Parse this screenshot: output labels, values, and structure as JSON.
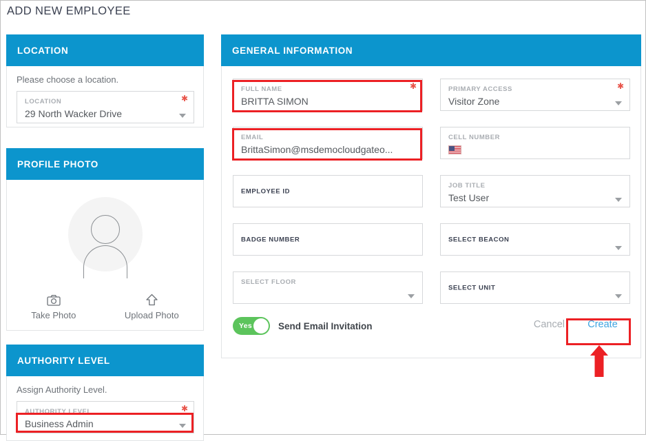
{
  "page": {
    "title": "ADD NEW EMPLOYEE",
    "accent_color": "#0c95cd",
    "annotation_color": "#ec2024",
    "link_color": "#3da3e0",
    "toggle_on_color": "#5cc45c"
  },
  "location_panel": {
    "heading": "LOCATION",
    "helper": "Please choose a location.",
    "field": {
      "label": "LOCATION",
      "value": "29 North Wacker Drive",
      "required": true
    }
  },
  "profile_panel": {
    "heading": "PROFILE PHOTO",
    "avatar_icon": "user-avatar-icon",
    "actions": [
      {
        "icon": "camera-icon",
        "label": "Take Photo"
      },
      {
        "icon": "upload-arrow-icon",
        "label": "Upload Photo"
      }
    ]
  },
  "authority_panel": {
    "heading": "AUTHORITY LEVEL",
    "helper": "Assign Authority Level.",
    "field": {
      "label": "AUTHORITY LEVEL",
      "value": "Business Admin",
      "required": true,
      "highlighted": true
    }
  },
  "general_panel": {
    "heading": "GENERAL INFORMATION",
    "fields": [
      {
        "name": "full-name",
        "label": "FULL NAME",
        "value": "BRITTA SIMON",
        "required": true,
        "dropdown": false,
        "highlighted": true
      },
      {
        "name": "primary-access",
        "label": "PRIMARY ACCESS",
        "value": "Visitor Zone",
        "required": true,
        "dropdown": true,
        "highlighted": false
      },
      {
        "name": "email",
        "label": "EMAIL",
        "value": "BrittaSimon@msdemocloudgateo...",
        "required": false,
        "dropdown": false,
        "highlighted": true
      },
      {
        "name": "cell-number",
        "label": "CELL NUMBER",
        "value": "",
        "required": false,
        "dropdown": false,
        "highlighted": false,
        "flag": "us-flag-icon"
      },
      {
        "name": "employee-id",
        "label": "EMPLOYEE ID",
        "value": "",
        "required": false,
        "dropdown": false,
        "highlighted": false
      },
      {
        "name": "job-title",
        "label": "JOB TITLE",
        "value": "Test User",
        "required": false,
        "dropdown": true,
        "highlighted": false
      },
      {
        "name": "badge-number",
        "label": "BADGE NUMBER",
        "value": "",
        "required": false,
        "dropdown": false,
        "highlighted": false
      },
      {
        "name": "select-beacon",
        "label": "SELECT BEACON",
        "value": "",
        "required": false,
        "dropdown": true,
        "highlighted": false
      },
      {
        "name": "select-floor",
        "label": "SELECT FLOOR",
        "value": "",
        "required": false,
        "dropdown": true,
        "highlighted": false
      },
      {
        "name": "select-unit",
        "label": "SELECT UNIT",
        "value": "",
        "required": false,
        "dropdown": true,
        "highlighted": false
      }
    ],
    "footer": {
      "toggle_state": "Yes",
      "toggle_label": "Send Email Invitation",
      "cancel_label": "Cancel",
      "create_label": "Create",
      "create_highlighted": true
    }
  }
}
